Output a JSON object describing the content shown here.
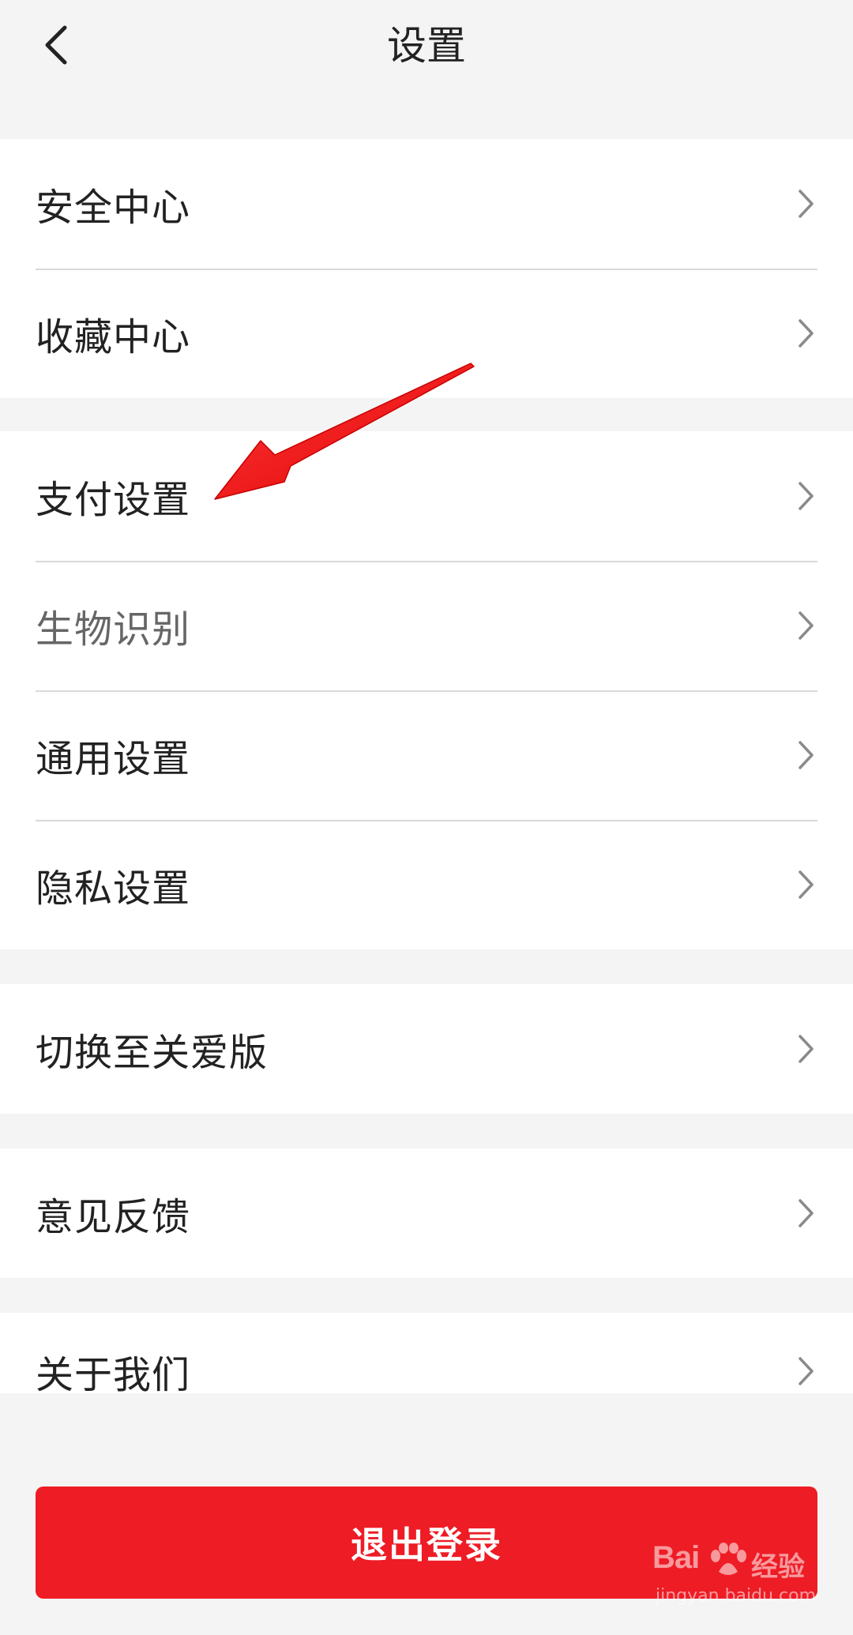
{
  "header": {
    "title": "设置"
  },
  "groups": [
    {
      "items": [
        {
          "label": "安全中心"
        },
        {
          "label": "收藏中心"
        }
      ]
    },
    {
      "items": [
        {
          "label": "支付设置"
        },
        {
          "label": "生物识别"
        },
        {
          "label": "通用设置"
        },
        {
          "label": "隐私设置"
        }
      ]
    },
    {
      "items": [
        {
          "label": "切换至关爱版"
        }
      ]
    },
    {
      "items": [
        {
          "label": "意见反馈"
        }
      ]
    },
    {
      "items": [
        {
          "label": "关于我们"
        }
      ]
    }
  ],
  "logout": {
    "label": "退出登录"
  },
  "watermark": {
    "brand": "Bai",
    "cn": "经验",
    "url": "jingyan.baidu.com"
  },
  "colors": {
    "accent": "#ee1c25",
    "background": "#f4f4f4",
    "annotation_arrow": "#ff0000"
  }
}
